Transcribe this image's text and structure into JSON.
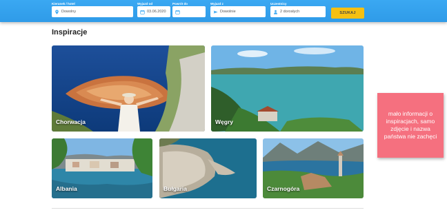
{
  "search": {
    "destination": {
      "label": "Kierunek / hotel",
      "value": "Dowolny"
    },
    "departure_from": {
      "label": "Wyjazd od",
      "value": "03.06.2020"
    },
    "return_until": {
      "label": "Powrót do",
      "value": ""
    },
    "departure_city": {
      "label": "Wyjazd z",
      "value": "Dowolnie"
    },
    "participants": {
      "label": "Uczestnicy",
      "value": "2 dorosłych"
    },
    "button_label": "SZUKAJ",
    "accent_color": "#3aa8f2",
    "button_color": "#f5c013"
  },
  "main": {
    "title": "Inspiracje",
    "cards": [
      {
        "name": "Chorwacja"
      },
      {
        "name": "Węgry"
      },
      {
        "name": "Albania"
      },
      {
        "name": "Bułgaria"
      },
      {
        "name": "Czarnogóra"
      }
    ]
  },
  "sticky_note": {
    "text": "mało informacji o inspiracjach, samo zdjęcie i nazwa państwa nie zachęci",
    "color": "#f5707f"
  }
}
